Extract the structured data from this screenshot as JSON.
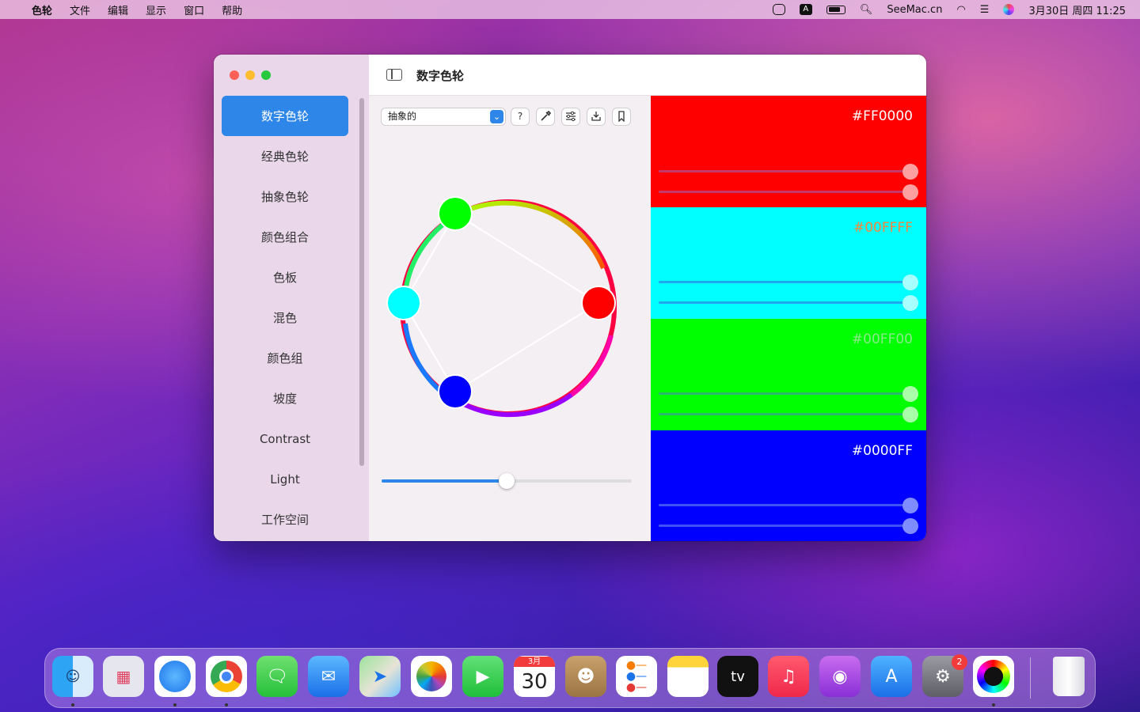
{
  "menubar": {
    "app_name": "色轮",
    "items": [
      "文件",
      "编辑",
      "显示",
      "窗口",
      "帮助"
    ],
    "status": {
      "input_label": "A",
      "website": "SeeMac.cn",
      "datetime": "3月30日 周四 11:25"
    }
  },
  "window": {
    "title": "数字色轮",
    "sidebar": {
      "items": [
        "数字色轮",
        "经典色轮",
        "抽象色轮",
        "颜色组合",
        "色板",
        "混色",
        "颜色组",
        "坡度",
        "Contrast",
        "Light",
        "工作空间"
      ],
      "selected": "数字色轮"
    },
    "controls": {
      "mode_value": "抽象的",
      "help_label": "?",
      "slider_value_fraction": 0.5
    },
    "swatches": [
      {
        "hex": "#FF0000",
        "color": "#ff0000"
      },
      {
        "hex": "#00FFFF",
        "color": "#00ffff"
      },
      {
        "hex": "#00FF00",
        "color": "#00ff00"
      },
      {
        "hex": "#0000FF",
        "color": "#0000ff"
      }
    ]
  },
  "dock": {
    "apps": [
      "finder-icon",
      "launchpad-icon",
      "safari-icon",
      "chrome-icon",
      "messages-icon",
      "mail-icon",
      "maps-icon",
      "photos-icon",
      "facetime-icon",
      "calendar-icon",
      "contacts-icon",
      "reminders-icon",
      "notes-icon",
      "tv-icon",
      "music-icon",
      "podcasts-icon",
      "app-store-icon",
      "system-preferences-icon",
      "color-wheel-icon",
      "trash-icon"
    ],
    "calendar": {
      "month": "3月",
      "day": "30"
    },
    "tv_label": "tv",
    "settings_badge": "2"
  }
}
